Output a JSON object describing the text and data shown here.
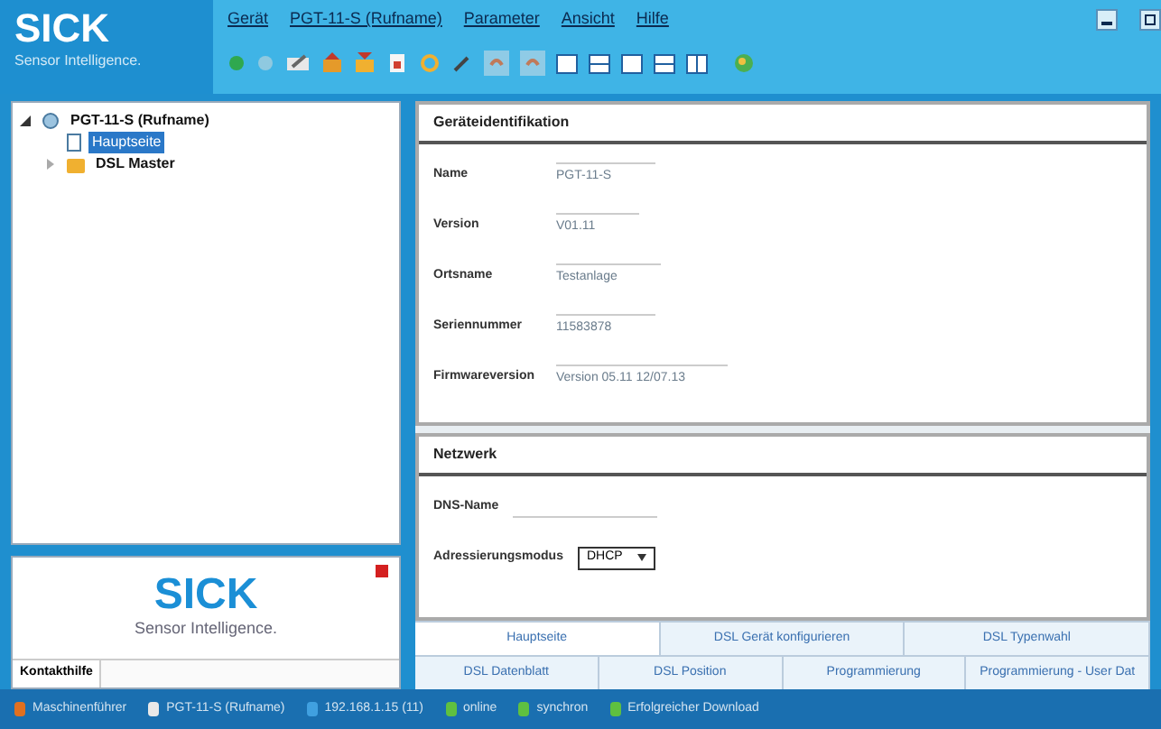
{
  "header": {
    "logo": "SICK",
    "tagline": "Sensor Intelligence."
  },
  "menu": [
    "Gerät",
    "PGT-11-S (Rufname)",
    "Parameter",
    "Ansicht",
    "Hilfe"
  ],
  "tree": [
    {
      "label": "PGT-11-S (Rufname)",
      "expanded": true,
      "selected": false,
      "children": [
        {
          "label": "Hauptseite",
          "selected": true
        },
        {
          "label": "DSL Master",
          "selected": false,
          "expanded": false
        }
      ]
    }
  ],
  "logo_panel": {
    "logo": "SICK",
    "tagline": "Sensor Intelligence.",
    "contact_label": "Kontakthilfe"
  },
  "sections": [
    {
      "title": "Geräteidentifikation",
      "fields": [
        {
          "label": "Name",
          "value": "PGT-11-S"
        },
        {
          "label": "Version",
          "value": "V01.11"
        },
        {
          "label": "Ortsname",
          "value": "Testanlage"
        },
        {
          "label": "Seriennummer",
          "value": "11583878"
        },
        {
          "label": "Firmwareversion",
          "value": "Version 05.11 12/07.13"
        }
      ]
    },
    {
      "title": "Netzwerk",
      "fields": [
        {
          "label": "DNS-Name",
          "kind": "text"
        },
        {
          "label": "Adressierungsmodus",
          "kind": "select",
          "value": "DHCP"
        }
      ]
    }
  ],
  "tabs": [
    [
      {
        "label": "Hauptseite",
        "selected": true
      },
      {
        "label": "DSL Gerät konfigurieren",
        "selected": false
      },
      {
        "label": "DSL Typenwahl",
        "selected": false
      }
    ],
    [
      {
        "label": "DSL Datenblatt",
        "selected": false
      },
      {
        "label": "DSL Position",
        "selected": false
      },
      {
        "label": "Programmierung",
        "selected": false
      },
      {
        "label": "Programmierung - User Dat",
        "selected": false
      }
    ]
  ],
  "status_bar": [
    "Maschinenführer",
    "PGT-11-S (Rufname)",
    "192.168.1.15 (11)",
    "online",
    "synchron",
    "Erfolgreicher Download"
  ]
}
